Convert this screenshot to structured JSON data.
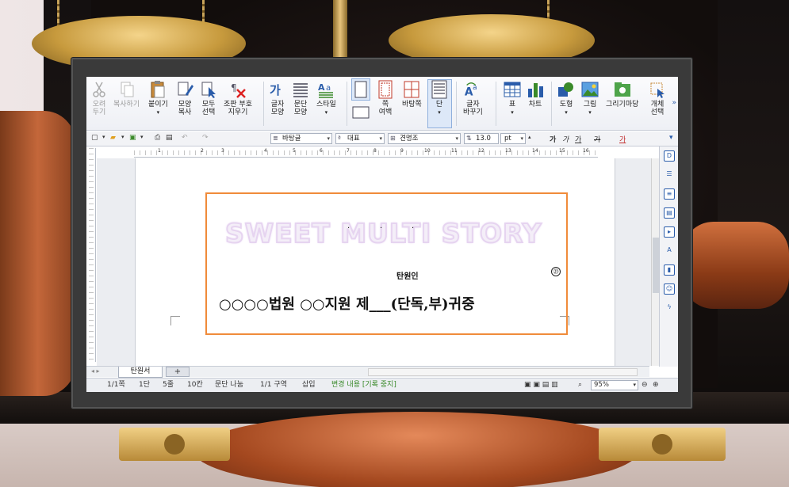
{
  "ribbon": {
    "cut": "오려\n두기",
    "copy": "복사하기",
    "paste": "붙이기",
    "format_copy": "모양\n복사",
    "select_all": "모두\n선택",
    "clear_format": "조판 부호\n지우기",
    "char_shape": "글자\n모양",
    "para_shape": "문단\n모양",
    "style": "스타일",
    "page_margin": "쪽\n여백",
    "background_page": "바탕쪽",
    "columns": "단",
    "change_case": "글자\n바꾸기",
    "table": "표",
    "chart": "차트",
    "shapes": "도형",
    "picture": "그림",
    "drawing_market": "그리기마당",
    "select_object": "개체\n선택"
  },
  "toolbar": {
    "style_value": "바탕글",
    "font_lang": "대표",
    "font_name": "견명조",
    "font_size": "13.0",
    "font_unit": "pt",
    "bold": "가",
    "italic": "가",
    "underline": "가",
    "strike": "가",
    "color": "가"
  },
  "document": {
    "watermark": "SWEET MULTI STORY",
    "dots": [
      ".",
      ".",
      "."
    ],
    "petitioner_label": "탄원인",
    "seal": "㉑",
    "court_line": "○○○○법원 ○○지원 제___(단독,부)귀중"
  },
  "tabs": {
    "doc_tab": "탄원서",
    "add": "+"
  },
  "status": {
    "page": "1/1쪽",
    "column": "1단",
    "line": "5줄",
    "col": "10칸",
    "para_break": "문단 나눔",
    "section": "1/1 구역",
    "insert": "삽입",
    "track_changes": "변경 내용 [기록 중지]",
    "zoom": "95%"
  },
  "colors": {
    "accent_blue": "#2a5caa",
    "frame_orange": "#f08b3a",
    "status_green": "#3a8a2a"
  }
}
